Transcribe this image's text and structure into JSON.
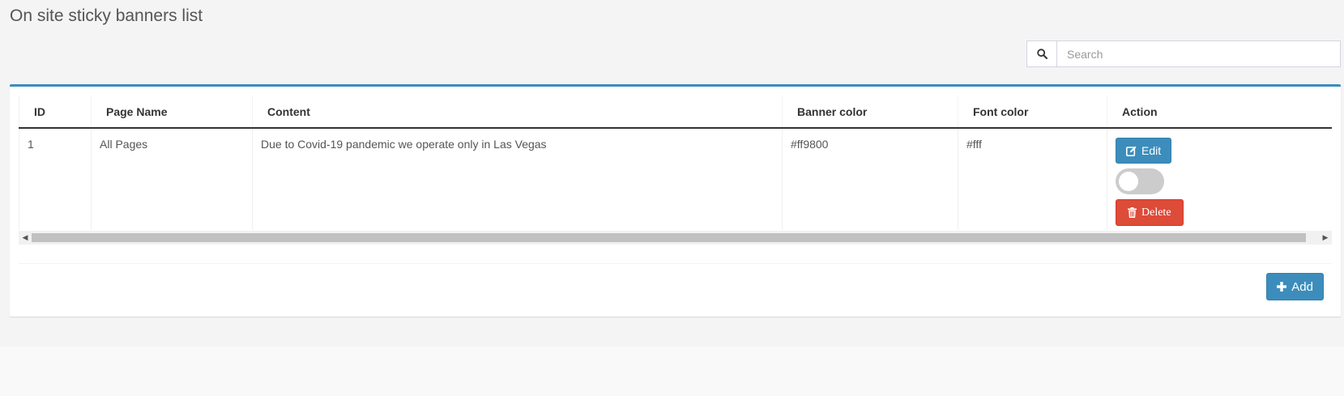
{
  "page": {
    "title": "On site sticky banners list"
  },
  "search": {
    "placeholder": "Search",
    "value": ""
  },
  "table": {
    "columns": [
      "ID",
      "Page Name",
      "Content",
      "Banner color",
      "Font color",
      "Action"
    ],
    "rows": [
      {
        "id": "1",
        "page_name": "All Pages",
        "content": "Due to Covid-19 pandemic we operate only in Las Vegas",
        "banner_color": "#ff9800",
        "font_color": "#fff",
        "active": false
      }
    ],
    "actions": {
      "edit_label": "Edit",
      "delete_label": "Delete"
    }
  },
  "footer": {
    "add_label": "Add"
  },
  "colors": {
    "primary": "#3c8dbc",
    "danger": "#dd4b39",
    "toggle_off": "#cccccc"
  },
  "icons": {
    "search": "search-icon",
    "edit": "edit-icon",
    "delete": "trash-icon",
    "add": "plus-icon"
  }
}
